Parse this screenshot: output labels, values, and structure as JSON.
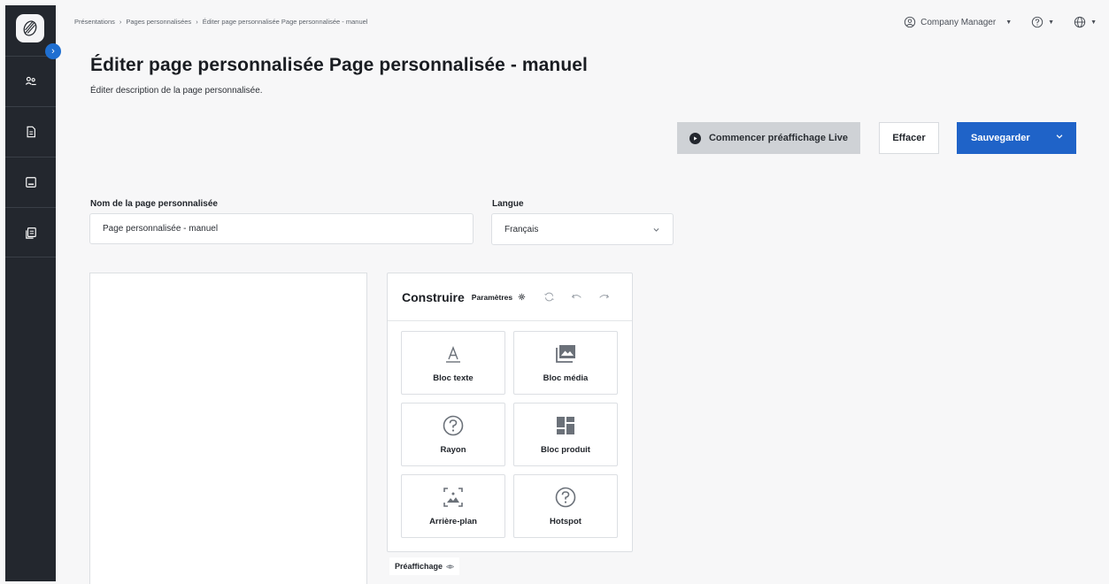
{
  "breadcrumb": {
    "items": [
      "Présentations",
      "Pages personnalisées",
      "Éditer page personnalisée Page personnalisée - manuel"
    ]
  },
  "topbar": {
    "user": "Company Manager"
  },
  "page": {
    "title": "Éditer page personnalisée Page personnalisée - manuel",
    "description": "Éditer description de la page personnalisée."
  },
  "actions": {
    "preview_label": "Commencer préaffichage Live",
    "clear_label": "Effacer",
    "save_label": "Sauvegarder"
  },
  "form": {
    "name_label": "Nom de la page personnalisée",
    "name_value": "Page personnalisée - manuel",
    "language_label": "Langue",
    "language_value": "Français"
  },
  "builder": {
    "title": "Construire",
    "params_label": "Paramètres",
    "tiles": [
      {
        "label": "Bloc texte",
        "icon": "text-icon"
      },
      {
        "label": "Bloc média",
        "icon": "media-icon"
      },
      {
        "label": "Rayon",
        "icon": "question-icon"
      },
      {
        "label": "Bloc produit",
        "icon": "product-grid-icon"
      },
      {
        "label": "Arrière-plan",
        "icon": "background-icon"
      },
      {
        "label": "Hotspot",
        "icon": "question-icon"
      }
    ]
  },
  "preview_tab": {
    "label": "Préaffichage"
  },
  "colors": {
    "sidebar": "#23272e",
    "primary": "#1f63c8",
    "preview_button": "#cfd2d6"
  }
}
